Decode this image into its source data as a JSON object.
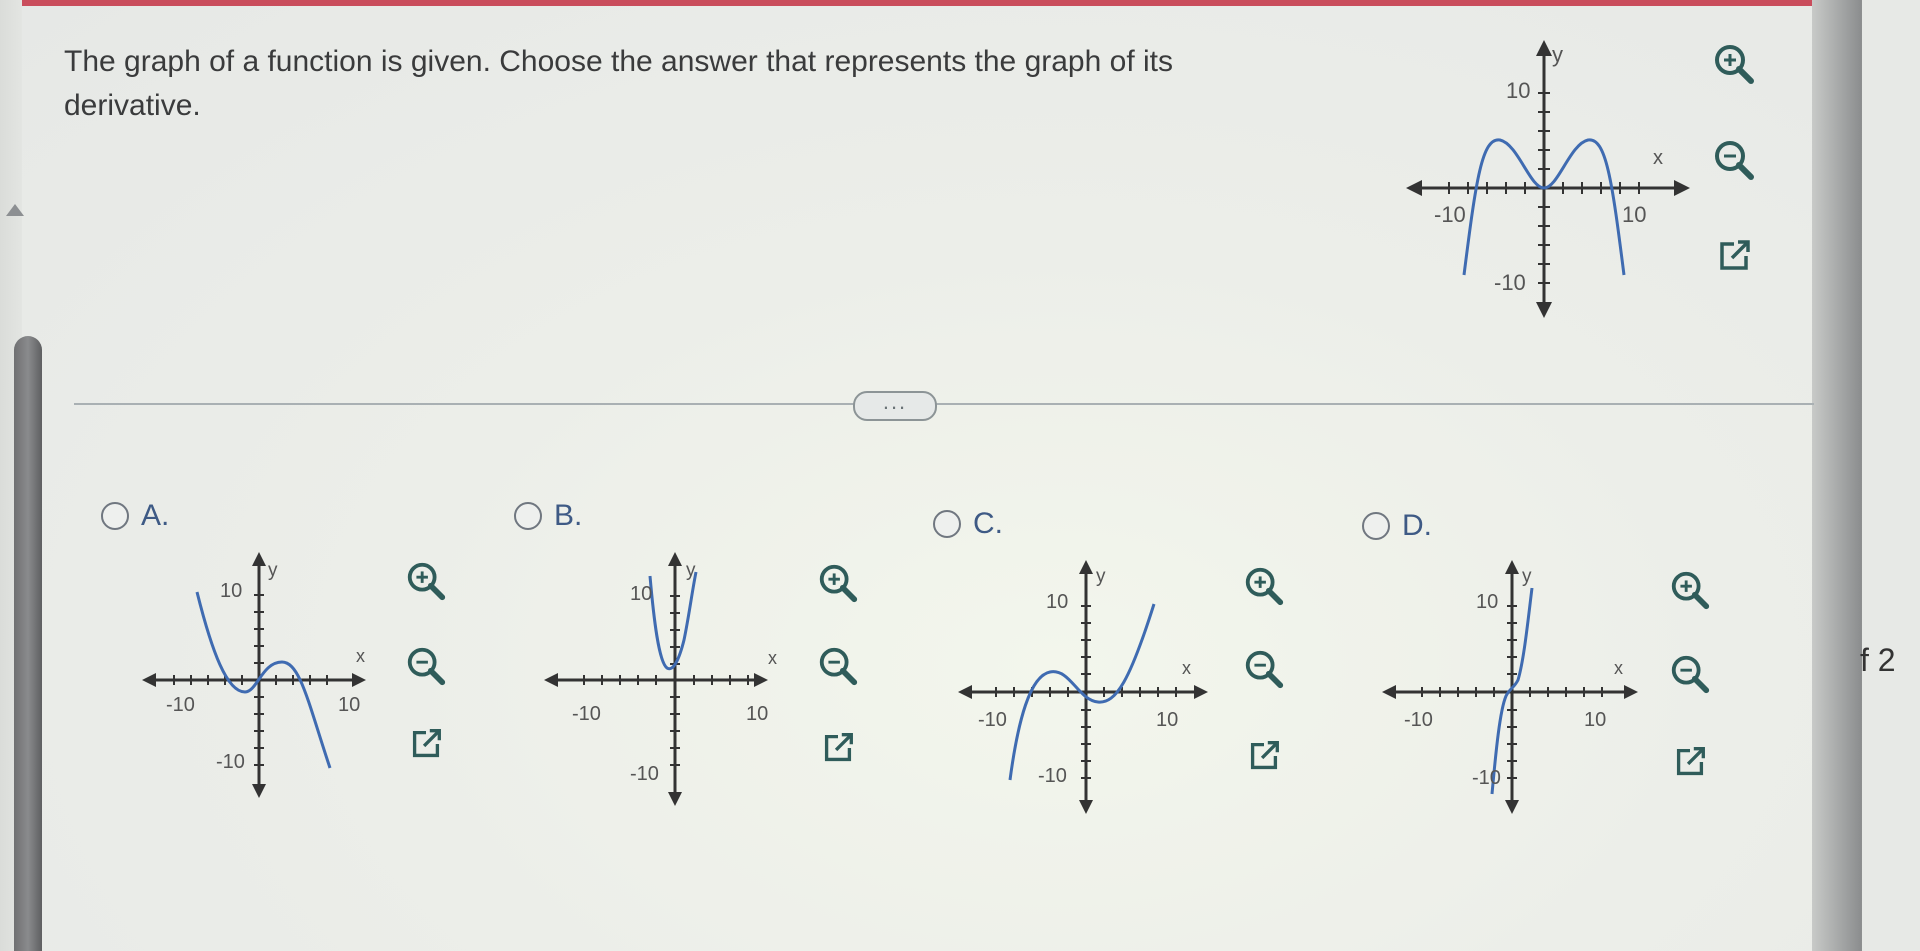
{
  "question": {
    "line1": "The graph of a function is given. Choose the answer that represents the graph of its",
    "line2": "derivative."
  },
  "side_text": "f 2",
  "divider": {
    "ellipsis": "..."
  },
  "axis_labels": {
    "x": "x",
    "y": "y",
    "pos10": "10",
    "neg10": "-10"
  },
  "icons": {
    "zoom_in": "zoom-in-icon",
    "zoom_out": "zoom-out-icon",
    "popout": "open-new-window-icon"
  },
  "options": [
    {
      "letter": "A.",
      "selected": false
    },
    {
      "letter": "B.",
      "selected": false
    },
    {
      "letter": "C.",
      "selected": false
    },
    {
      "letter": "D.",
      "selected": false
    }
  ],
  "colors": {
    "curve": "#3f6bb1",
    "header_bar": "#c94d5c",
    "option_label": "#3e5a85",
    "icon": "#2f5c5a"
  }
}
